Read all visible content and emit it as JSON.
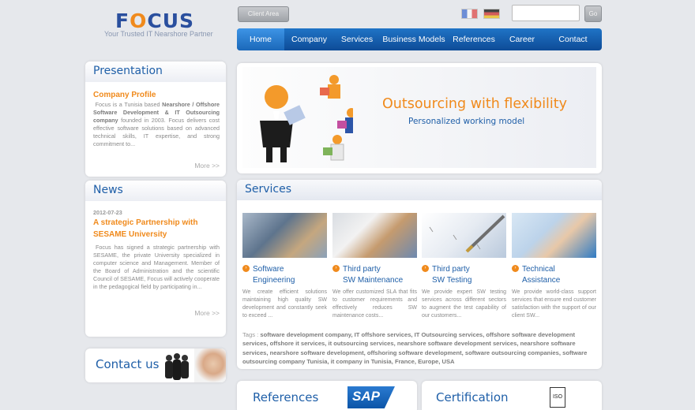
{
  "header": {
    "logo_prefix": "F",
    "logo_o": "O",
    "logo_suffix": "CUS",
    "tagline": "Your Trusted IT Nearshore Partner",
    "client_area_label": "Client Area",
    "search_value": "",
    "go_label": "Go"
  },
  "nav": {
    "items": [
      "Home",
      "Company",
      "Services",
      "Business Models",
      "References",
      "Career",
      "Contact"
    ],
    "active": "Home"
  },
  "presentation": {
    "title": "Presentation",
    "profile_heading": "Company Profile",
    "text_1": "Focus is a Tunisia based ",
    "text_bold": "Nearshore / Offshore Software Development & IT Outsourcing company",
    "text_2": " founded in 2003. Focus delivers cost effective software solutions based on advanced technical skills, IT expertise, and strong commitment to...",
    "more": "More >>"
  },
  "news": {
    "title": "News",
    "date": "2012-07-23",
    "heading": "A strategic Partnership with SESAME University",
    "text": "Focus has signed a strategic partnership with SESAME, the private University specialized in computer science and Management. Member of the Board of Administration and the scientific Council of SESAME, Focus will actively cooperate in the pedagogical field by participating in...",
    "more": "More >>"
  },
  "contact": {
    "label": "Contact us"
  },
  "hero": {
    "headline": "Outsourcing with flexibility",
    "subline": "Personalized working model"
  },
  "services": {
    "title": "Services",
    "items": [
      {
        "title_1": "Software",
        "title_2": "Engineering",
        "desc": "We create efficient solutions maintaining high quality SW development and constantly seek to exceed ..."
      },
      {
        "title_1": "Third party",
        "title_2": "SW Maintenance",
        "desc": "We offer customized SLA that fits to customer requirements and effectively reduces SW maintenance costs..."
      },
      {
        "title_1": "Third party",
        "title_2": "SW Testing",
        "desc": "We provide expert SW testing services across different sectors to augment the test capability of our customers..."
      },
      {
        "title_1": "Technical",
        "title_2": "Assistance",
        "desc": "We provide world-class support services that ensure end customer satisfaction with the support of our client SW..."
      }
    ],
    "tags_label": "Tags :",
    "tags": "software development company, IT offshore services, IT Outsourcing services, offshore software development services, offshore it services, it outsourcing services, nearshore software development services, nearshore software services, nearshore software development, offshoring software development, software outsourcing companies, software outsourcing company Tunisia, it company in Tunisia, France, Europe, USA"
  },
  "bottom": {
    "references_label": "References",
    "sap_label": "SAP",
    "certification_label": "Certification",
    "cert_badge": "ISO"
  },
  "colors": {
    "brand_blue": "#1f5fa8",
    "accent_orange": "#f08a1c",
    "nav_blue": "#0e4b97"
  }
}
